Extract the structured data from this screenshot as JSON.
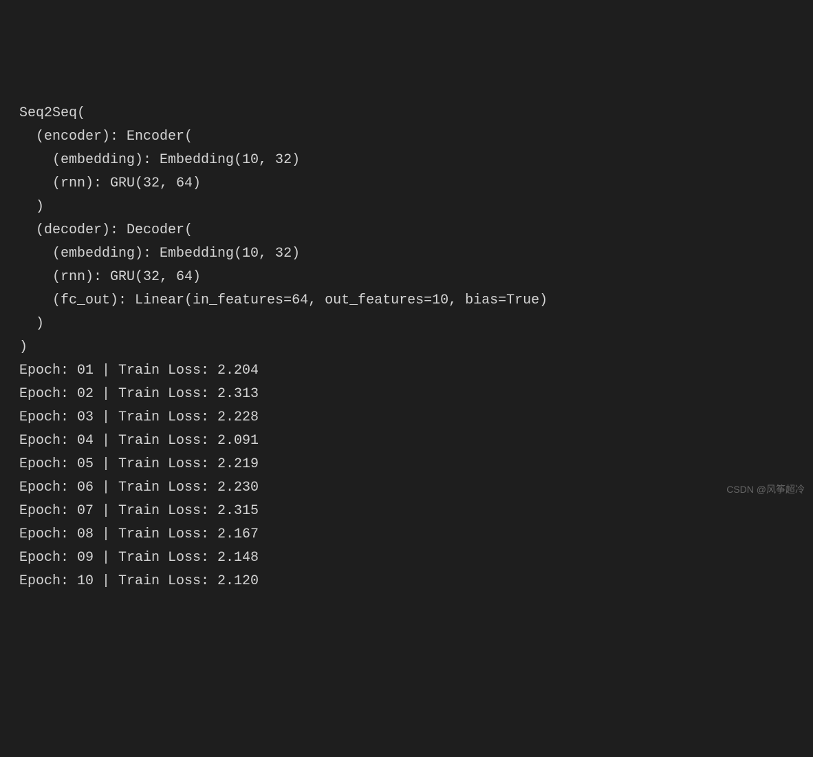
{
  "model": {
    "lines": [
      "Seq2Seq(",
      "  (encoder): Encoder(",
      "    (embedding): Embedding(10, 32)",
      "    (rnn): GRU(32, 64)",
      "  )",
      "  (decoder): Decoder(",
      "    (embedding): Embedding(10, 32)",
      "    (rnn): GRU(32, 64)",
      "    (fc_out): Linear(in_features=64, out_features=10, bias=True)",
      "  )",
      ")"
    ]
  },
  "training": {
    "epochs": [
      {
        "epoch": "01",
        "loss": "2.204"
      },
      {
        "epoch": "02",
        "loss": "2.313"
      },
      {
        "epoch": "03",
        "loss": "2.228"
      },
      {
        "epoch": "04",
        "loss": "2.091"
      },
      {
        "epoch": "05",
        "loss": "2.219"
      },
      {
        "epoch": "06",
        "loss": "2.230"
      },
      {
        "epoch": "07",
        "loss": "2.315"
      },
      {
        "epoch": "08",
        "loss": "2.167"
      },
      {
        "epoch": "09",
        "loss": "2.148"
      },
      {
        "epoch": "10",
        "loss": "2.120"
      }
    ]
  },
  "watermark": "CSDN @风筝超冷"
}
